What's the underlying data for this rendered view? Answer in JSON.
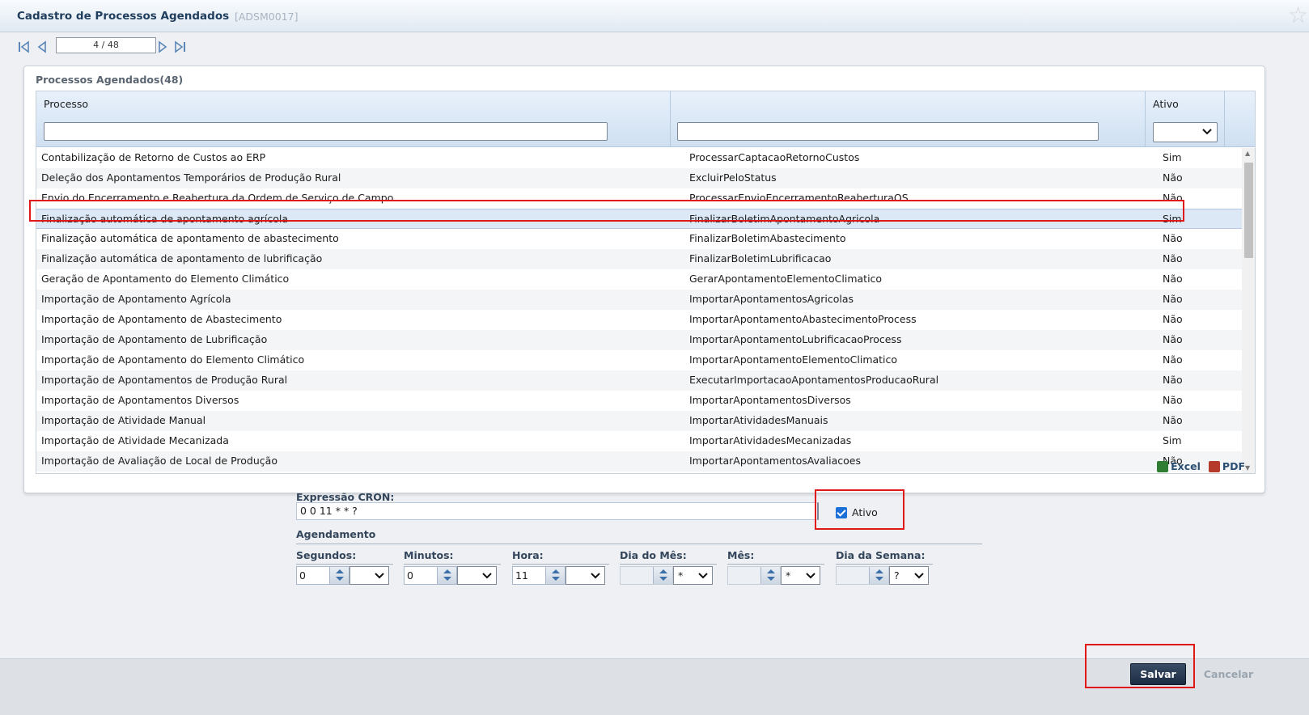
{
  "window": {
    "title": "Cadastro de Processos Agendados",
    "code": "[ADSM0017]"
  },
  "pager": {
    "position": "4 / 48"
  },
  "grid": {
    "title": "Processos Agendados(48)",
    "columns": [
      "Processo",
      "",
      "Ativo"
    ],
    "rows": [
      [
        "Contabilização de Retorno de Custos ao ERP",
        "ProcessarCaptacaoRetornoCustos",
        "Sim"
      ],
      [
        "Deleção dos Apontamentos Temporários de Produção Rural",
        "ExcluirPeloStatus",
        "Não"
      ],
      [
        "Envio do Encerramento e Reabertura da Ordem de Serviço de Campo",
        "ProcessarEnvioEncerramentoReaberturaOS",
        "Não"
      ],
      [
        "Finalização automática de apontamento agrícola",
        "FinalizarBoletimApontamentoAgricola",
        "Sim"
      ],
      [
        "Finalização automática de apontamento de abastecimento",
        "FinalizarBoletimAbastecimento",
        "Não"
      ],
      [
        "Finalização automática de apontamento de lubrificação",
        "FinalizarBoletimLubrificacao",
        "Não"
      ],
      [
        "Geração de Apontamento do Elemento Climático",
        "GerarApontamentoElementoClimatico",
        "Não"
      ],
      [
        "Importação de Apontamento Agrícola",
        "ImportarApontamentosAgricolas",
        "Não"
      ],
      [
        "Importação de Apontamento de Abastecimento",
        "ImportarApontamentoAbastecimentoProcess",
        "Não"
      ],
      [
        "Importação de Apontamento de Lubrificação",
        "ImportarApontamentoLubrificacaoProcess",
        "Não"
      ],
      [
        "Importação de Apontamento do Elemento Climático",
        "ImportarApontamentoElementoClimatico",
        "Não"
      ],
      [
        "Importação de Apontamentos de Produção Rural",
        "ExecutarImportacaoApontamentosProducaoRural",
        "Não"
      ],
      [
        "Importação de Apontamentos Diversos",
        "ImportarApontamentosDiversos",
        "Não"
      ],
      [
        "Importação de Atividade Manual",
        "ImportarAtividadesManuais",
        "Não"
      ],
      [
        "Importação de Atividade Mecanizada",
        "ImportarAtividadesMecanizadas",
        "Sim"
      ],
      [
        "Importação de Avaliação de Local de Produção",
        "ImportarApontamentosAvaliacoes",
        "Não"
      ]
    ],
    "selected_row": 3
  },
  "exports": {
    "excel": "Excel",
    "pdf": "PDF"
  },
  "form": {
    "cron_label": "Expressão CRON:",
    "cron_value": "0 0 11 * * ?",
    "ativo_label": "Ativo",
    "ativo_checked": true,
    "agendamento_label": "Agendamento",
    "fields": [
      {
        "label": "Segundos:",
        "value": "0",
        "select": ""
      },
      {
        "label": "Minutos:",
        "value": "0",
        "select": ""
      },
      {
        "label": "Hora:",
        "value": "11",
        "select": ""
      },
      {
        "label": "Dia do Mês:",
        "value": "",
        "select": "*"
      },
      {
        "label": "Mês:",
        "value": "",
        "select": "*"
      },
      {
        "label": "Dia da Semana:",
        "value": "",
        "select": "?"
      }
    ]
  },
  "footer": {
    "save": "Salvar",
    "cancel": "Cancelar"
  },
  "colors": {
    "highlight": "#e01818",
    "selected_row": "#dde8f6",
    "save_button": "#1b2b42"
  }
}
